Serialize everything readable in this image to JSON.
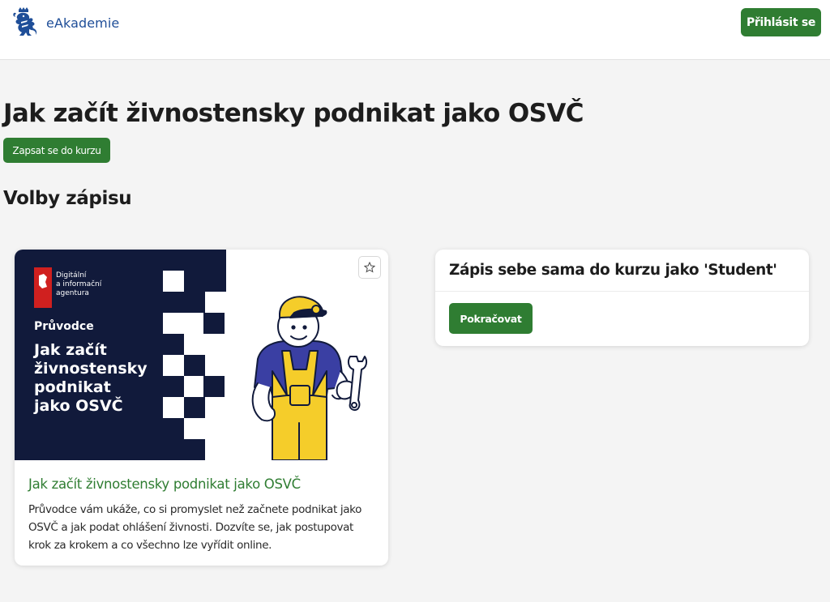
{
  "header": {
    "site_name": "eAkademie",
    "login_label": "Přihlásit se",
    "logo_icon": "czech-lion-icon"
  },
  "main": {
    "page_title": "Jak začít živnostensky podnikat jako OSVČ",
    "enrol_label": "Zapsat se do kurzu",
    "section_title": "Volby zápisu"
  },
  "course_card": {
    "image": {
      "agency_line1": "Digitální",
      "agency_line2": "a informační",
      "agency_line3": "agentura",
      "kicker": "Průvodce",
      "headline_line1": "Jak začít",
      "headline_line2": "živnostensky",
      "headline_line3": "podnikat",
      "headline_line4": "jako OSVČ"
    },
    "star_icon": "star-icon",
    "title": "Jak začít živnostensky podnikat jako OSVČ",
    "description": "Průvodce vám ukáže, co si promyslet než začnete podnikat jako OSVČ a jak podat ohlášení živnosti. Dozvíte se, jak postupovat krok za krokem a co všechno lze vyřídit online."
  },
  "enrol_option": {
    "title": "Zápis sebe sama do kurzu jako 'Student'",
    "continue_label": "Pokračovat"
  },
  "colors": {
    "accent_green": "#2f7d32",
    "brand_blue": "#1f4e98",
    "navy": "#111a3b",
    "agency_red": "#d0201f",
    "helmet_yellow": "#f5cd2a"
  }
}
